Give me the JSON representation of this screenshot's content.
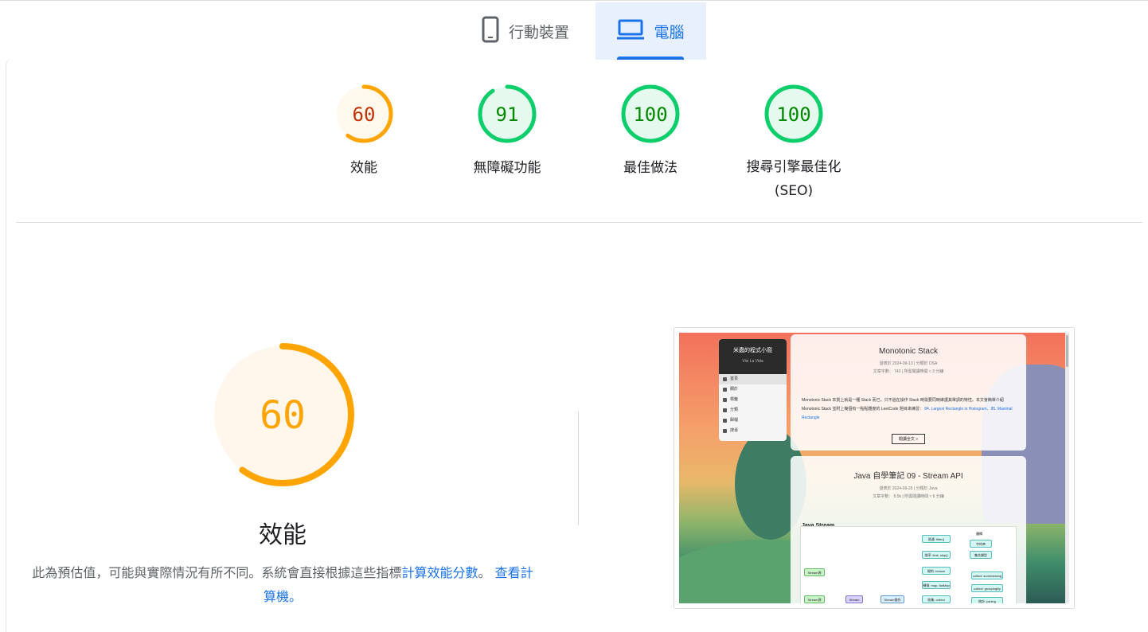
{
  "tabs": [
    {
      "label": "行動裝置",
      "icon": "mobile-phone-icon",
      "active": false
    },
    {
      "label": "電腦",
      "icon": "laptop-icon",
      "active": true
    }
  ],
  "colors": {
    "accent": "#1a73e8",
    "average": "#ffa400",
    "average_text": "#c33300",
    "pass": "#0cce6b",
    "pass_text": "#008800"
  },
  "gauges": [
    {
      "score": "60",
      "label": "效能",
      "fraction": 0.6,
      "status": "average"
    },
    {
      "score": "91",
      "label": "無障礙功能",
      "fraction": 0.91,
      "status": "pass"
    },
    {
      "score": "100",
      "label": "最佳做法",
      "fraction": 1.0,
      "status": "pass"
    },
    {
      "score": "100",
      "label": "搜尋引擎最佳化",
      "label2": "(SEO)",
      "fraction": 1.0,
      "status": "pass"
    }
  ],
  "performance": {
    "score": "60",
    "fraction": 0.6,
    "title": "效能",
    "desc_text": "此為預估值，可能與實際情況有所不同。系統會直接根據這些指標",
    "link1": "計算效能分數",
    "desc_sep": "。",
    "link2": "查看計算機。"
  },
  "screenshot": {
    "site_title": "米蟲的程式小窩",
    "site_subtitle": "Vivi La Vida",
    "menu": [
      "首頁",
      "關於",
      "標籤",
      "分類",
      "歸檔",
      "搜尋"
    ],
    "post1": {
      "title": "Monotonic Stack",
      "meta1": "發表於 2024-09-13 | 分類於 DSA",
      "meta2": "文章字數： 743 | 所需閱讀時間 ≈ 3 分鐘",
      "excerpt": "Monotonic Stack 本質上就是一種 Stack 而已，只不過在操作 Stack 時需要同時維護其單調的特性。本文會簡單介紹 Monotonic Stack 並附上幾個有一點點難度的 LeetCode 題目來練習：",
      "links": "84. Largest Rectangle in Histogram、85. Maximal Rectangle",
      "button": "閱讀全文 »"
    },
    "post2": {
      "title": "Java 自學筆記 09 - Stream API",
      "meta1": "發表於 2024-09-25 | 分類於 Java",
      "meta2": "文章字數： 6.5k | 所需閱讀時間 ≈ 6 分鐘",
      "section": "Java Stream",
      "nodes": [
        "Stream源",
        "Stream源",
        "Stream",
        "Stream操作",
        "過濾: filter()",
        "排序: limit, skip()",
        "規約: reduce",
        "轉換: map, flatMap",
        "收集: collect",
        "邏輯",
        "字符串",
        "集合類型",
        "collect: summarizing",
        "collect: groupingBy",
        "統計: joining"
      ]
    }
  }
}
